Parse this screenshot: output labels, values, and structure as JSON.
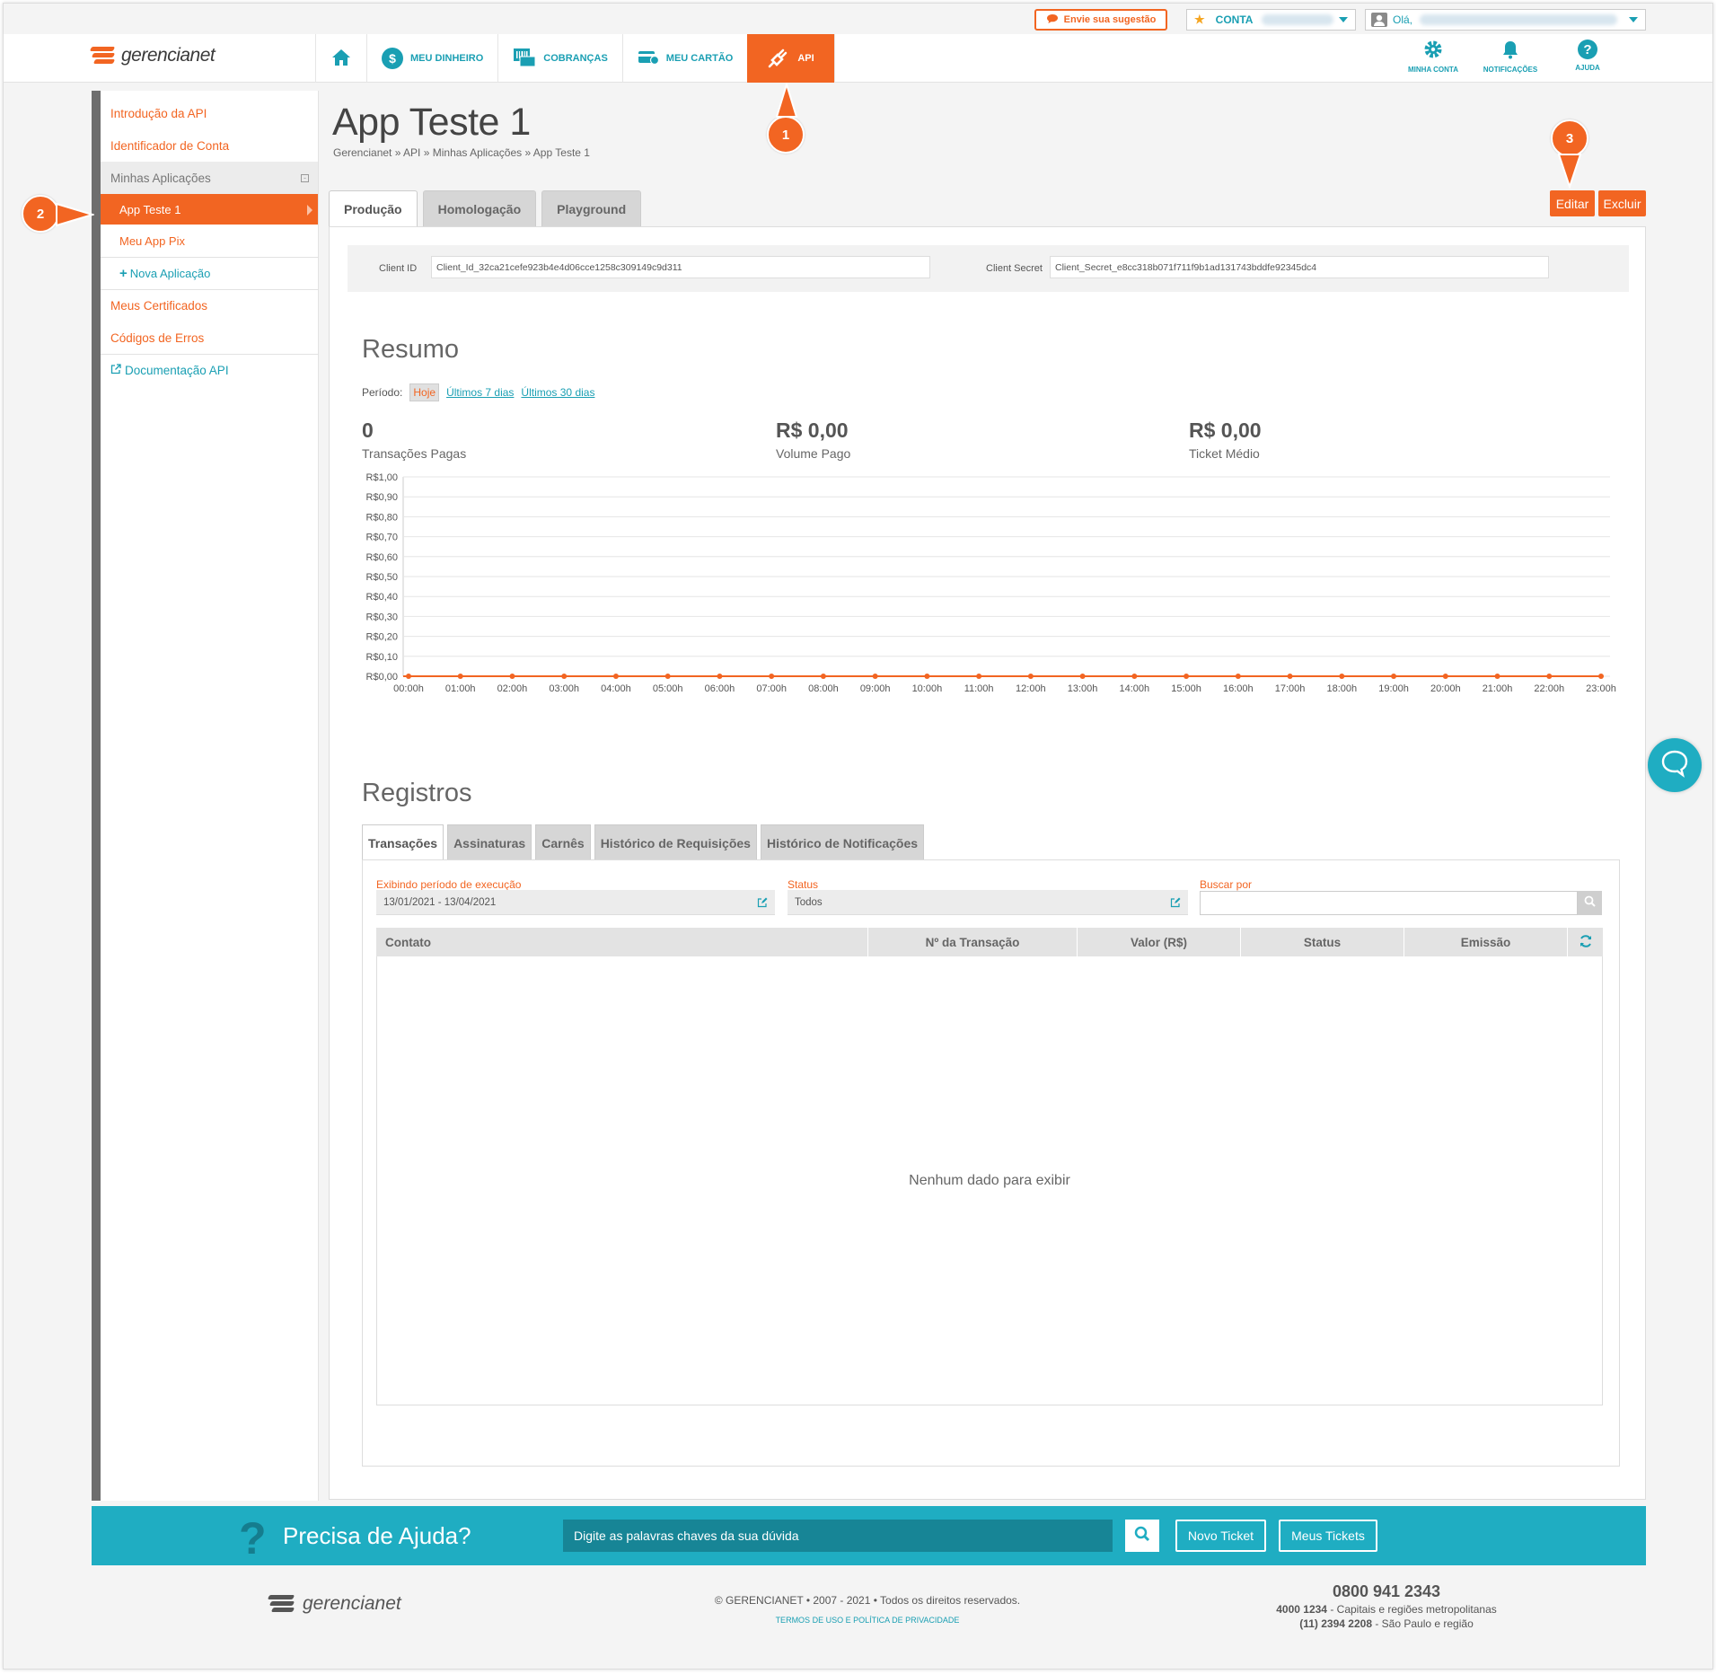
{
  "topbar": {
    "suggestion_label": "Envie sua sugestão",
    "account_label": "CONTA",
    "greeting": "Olá,"
  },
  "header": {
    "logo_text": "gerencianet",
    "nav": [
      {
        "label": "",
        "icon": "home-icon"
      },
      {
        "label": "MEU DINHEIRO",
        "icon": "dollar-icon"
      },
      {
        "label": "COBRANÇAS",
        "icon": "barcode-icon"
      },
      {
        "label": "MEU CARTÃO",
        "icon": "card-icon"
      },
      {
        "label": "API",
        "icon": "plug-icon",
        "active": true
      }
    ],
    "right_nav": [
      {
        "label": "MINHA CONTA",
        "icon": "gear-icon"
      },
      {
        "label": "NOTIFICAÇÕES",
        "icon": "bell-icon"
      },
      {
        "label": "AJUDA",
        "icon": "help-icon"
      }
    ]
  },
  "sidebar": {
    "items": [
      {
        "label": "Introdução da API"
      },
      {
        "label": "Identificador de Conta"
      },
      {
        "label": "Minhas Aplicações"
      },
      {
        "label": "App Teste 1"
      },
      {
        "label": "Meu App Pix"
      },
      {
        "label": "Nova Aplicação"
      },
      {
        "label": "Meus Certificados"
      },
      {
        "label": "Códigos de Erros"
      },
      {
        "label": "Documentação API"
      }
    ]
  },
  "markers": [
    "1",
    "2",
    "3"
  ],
  "page": {
    "title": "App Teste 1",
    "breadcrumb": "Gerencianet » API » Minhas Aplicações » App Teste 1",
    "tabs": [
      "Produção",
      "Homologação",
      "Playground"
    ],
    "edit_label": "Editar",
    "delete_label": "Excluir"
  },
  "credentials": {
    "client_id_label": "Client ID",
    "client_id_value": "Client_Id_32ca21cefe923b4e4d06cce1258c309149c9d311",
    "client_secret_label": "Client Secret",
    "client_secret_value": "Client_Secret_e8cc318b071f711f9b1ad131743bddfe92345dc4"
  },
  "resumo": {
    "title": "Resumo",
    "period_label": "Período:",
    "period_options": [
      "Hoje",
      "Últimos 7 dias",
      "Últimos 30 dias"
    ],
    "stats": [
      {
        "value": "0",
        "label": "Transações Pagas"
      },
      {
        "value": "R$ 0,00",
        "label": "Volume Pago"
      },
      {
        "value": "R$ 0,00",
        "label": "Ticket Médio"
      }
    ]
  },
  "chart_data": {
    "type": "line",
    "x": [
      "00:00h",
      "01:00h",
      "02:00h",
      "03:00h",
      "04:00h",
      "05:00h",
      "06:00h",
      "07:00h",
      "08:00h",
      "09:00h",
      "10:00h",
      "11:00h",
      "12:00h",
      "13:00h",
      "14:00h",
      "15:00h",
      "16:00h",
      "17:00h",
      "18:00h",
      "19:00h",
      "20:00h",
      "21:00h",
      "22:00h",
      "23:00h"
    ],
    "series": [
      {
        "values": [
          0,
          0,
          0,
          0,
          0,
          0,
          0,
          0,
          0,
          0,
          0,
          0,
          0,
          0,
          0,
          0,
          0,
          0,
          0,
          0,
          0,
          0,
          0,
          0
        ]
      }
    ],
    "y_ticks": [
      "R$0,00",
      "R$0,10",
      "R$0,20",
      "R$0,30",
      "R$0,40",
      "R$0,50",
      "R$0,60",
      "R$0,70",
      "R$0,80",
      "R$0,90",
      "R$1,00"
    ],
    "ylim": [
      0,
      1
    ],
    "grid": true,
    "color": "#f26522"
  },
  "registros": {
    "title": "Registros",
    "tabs": [
      "Transações",
      "Assinaturas",
      "Carnês",
      "Histórico de Requisições",
      "Histórico de Notificações"
    ],
    "period_label": "Exibindo período de execução",
    "period_value": "13/01/2021 - 13/04/2021",
    "status_label": "Status",
    "status_value": "Todos",
    "search_label": "Buscar por",
    "columns": [
      "Contato",
      "Nº da Transação",
      "Valor (R$)",
      "Status",
      "Emissão"
    ],
    "empty_message": "Nenhum dado para exibir"
  },
  "help": {
    "title": "Precisa de Ajuda?",
    "placeholder": "Digite as palavras chaves da sua dúvida",
    "new_ticket": "Novo Ticket",
    "my_tickets": "Meus Tickets"
  },
  "footer": {
    "logo_text": "gerencianet",
    "copyright": "© GERENCIANET • 2007 - 2021 • Todos os direitos reservados.",
    "terms": "TERMOS DE USO E POLÍTICA DE PRIVACIDADE",
    "phone_main": "0800 941 2343",
    "phone_line1_number": "4000 1234",
    "phone_line1_text": " - Capitais e regiões metropolitanas",
    "phone_line2_number": "(11) 2394 2208",
    "phone_line2_text": " - São Paulo e região"
  }
}
